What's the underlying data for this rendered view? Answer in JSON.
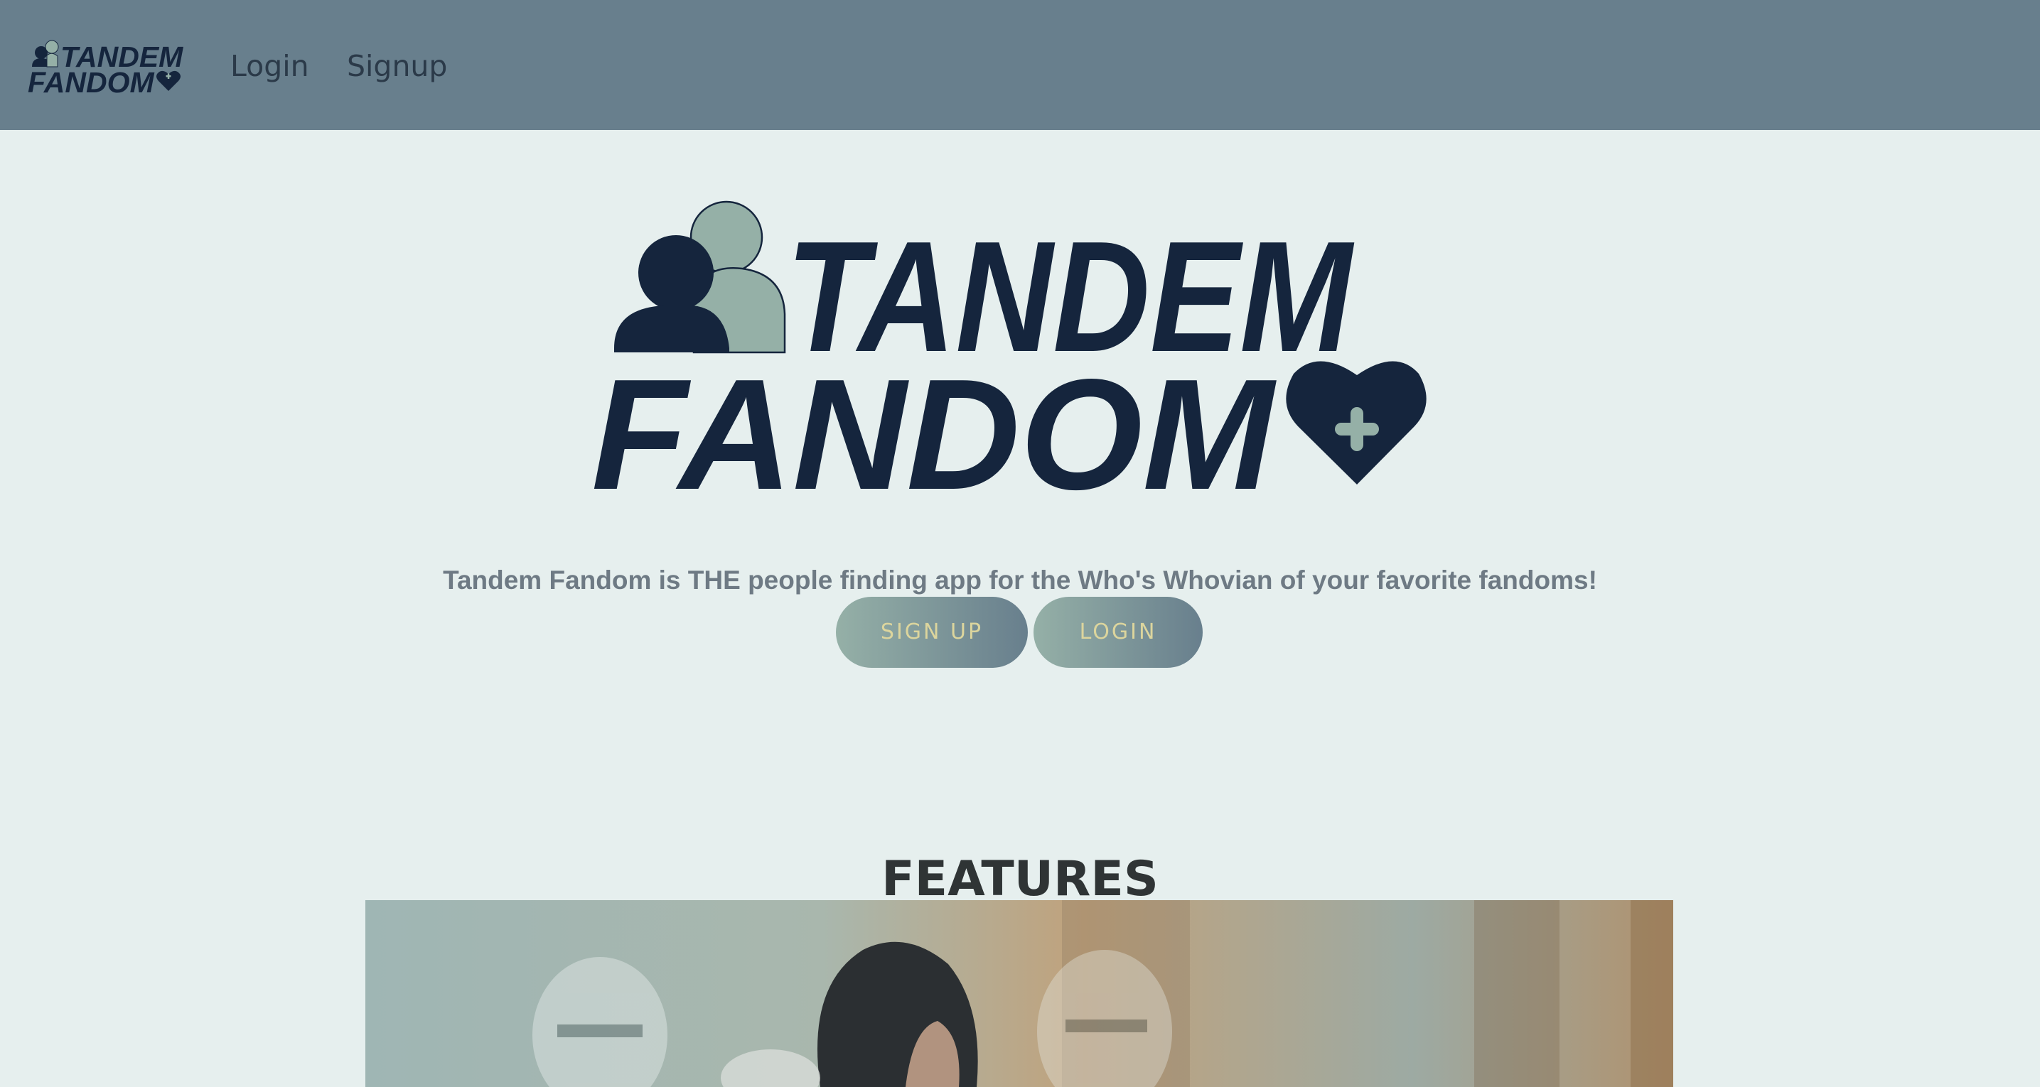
{
  "nav": {
    "logo_line1": "TANDEM",
    "logo_line2": "FANDOM",
    "links": [
      {
        "label": "Login"
      },
      {
        "label": "Signup"
      }
    ]
  },
  "hero": {
    "logo_line1": "TANDEM",
    "logo_line2": "FANDOM",
    "tagline": "Tandem Fandom is THE people finding app for the Who's Whovian of your favorite fandoms!",
    "buttons": {
      "signup": "SIGN UP",
      "login": "LOGIN"
    }
  },
  "features": {
    "title": "FEATURES"
  },
  "colors": {
    "navbar": "#687f8d",
    "background": "#e6efee",
    "navy": "#15253d",
    "sage": "#95b0a7",
    "button_text": "#dcd59d"
  }
}
